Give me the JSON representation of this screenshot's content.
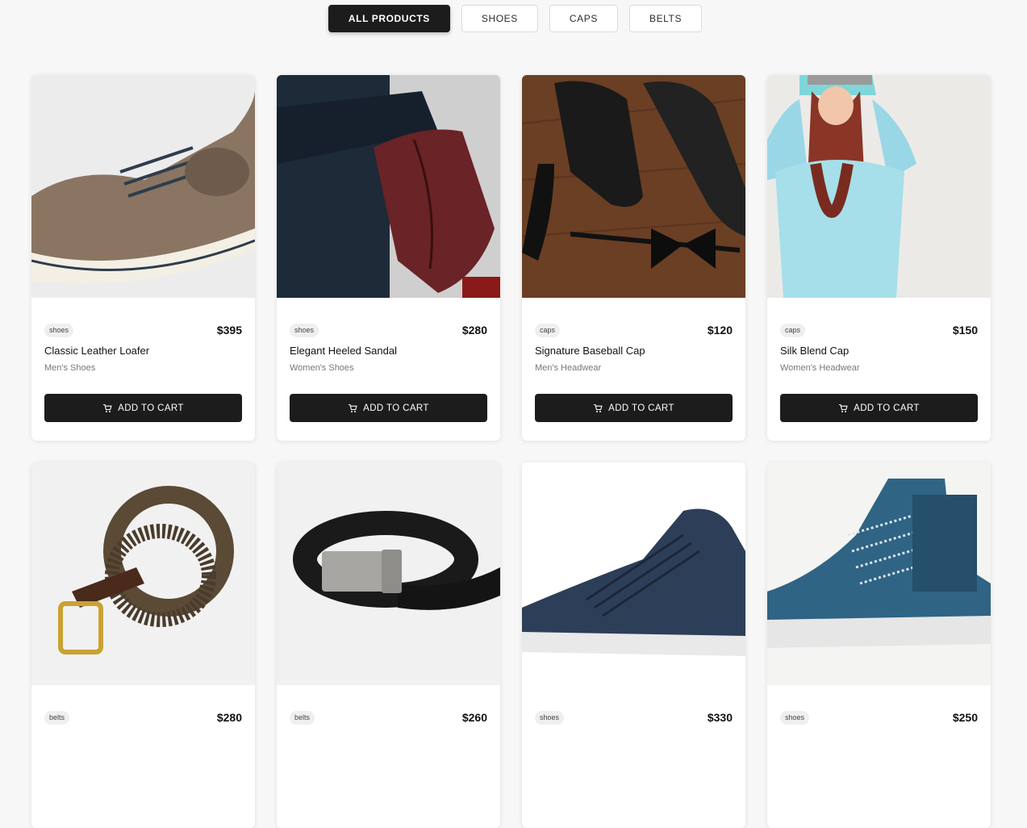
{
  "filters": [
    {
      "label": "ALL PRODUCTS",
      "active": true
    },
    {
      "label": "SHOES",
      "active": false
    },
    {
      "label": "CAPS",
      "active": false
    },
    {
      "label": "BELTS",
      "active": false
    }
  ],
  "products": [
    {
      "tag": "shoes",
      "price": "$395",
      "name": "Classic Leather Loafer",
      "subcategory": "Men's Shoes",
      "cart_label": "ADD TO CART",
      "image": "brown-canvas-sneaker"
    },
    {
      "tag": "shoes",
      "price": "$280",
      "name": "Elegant Heeled Sandal",
      "subcategory": "Women's Shoes",
      "cart_label": "ADD TO CART",
      "image": "burgundy-brogue"
    },
    {
      "tag": "caps",
      "price": "$120",
      "name": "Signature Baseball Cap",
      "subcategory": "Men's Headwear",
      "cart_label": "ADD TO CART",
      "image": "black-dress-shoes-bowtie"
    },
    {
      "tag": "caps",
      "price": "$150",
      "name": "Silk Blend Cap",
      "subcategory": "Women's Headwear",
      "cart_label": "ADD TO CART",
      "image": "woman-in-cap"
    },
    {
      "tag": "belts",
      "price": "$280",
      "name": "",
      "subcategory": "",
      "cart_label": "",
      "image": "braided-belt"
    },
    {
      "tag": "belts",
      "price": "$260",
      "name": "",
      "subcategory": "",
      "cart_label": "",
      "image": "black-leather-belt"
    },
    {
      "tag": "shoes",
      "price": "$330",
      "name": "",
      "subcategory": "",
      "cart_label": "",
      "image": "navy-high-top-sneaker"
    },
    {
      "tag": "shoes",
      "price": "$250",
      "name": "",
      "subcategory": "",
      "cart_label": "",
      "image": "blue-high-top-sneakers"
    }
  ],
  "colors": {
    "accent": "#1c1c1c",
    "background": "#f7f7f7",
    "card": "#ffffff"
  }
}
